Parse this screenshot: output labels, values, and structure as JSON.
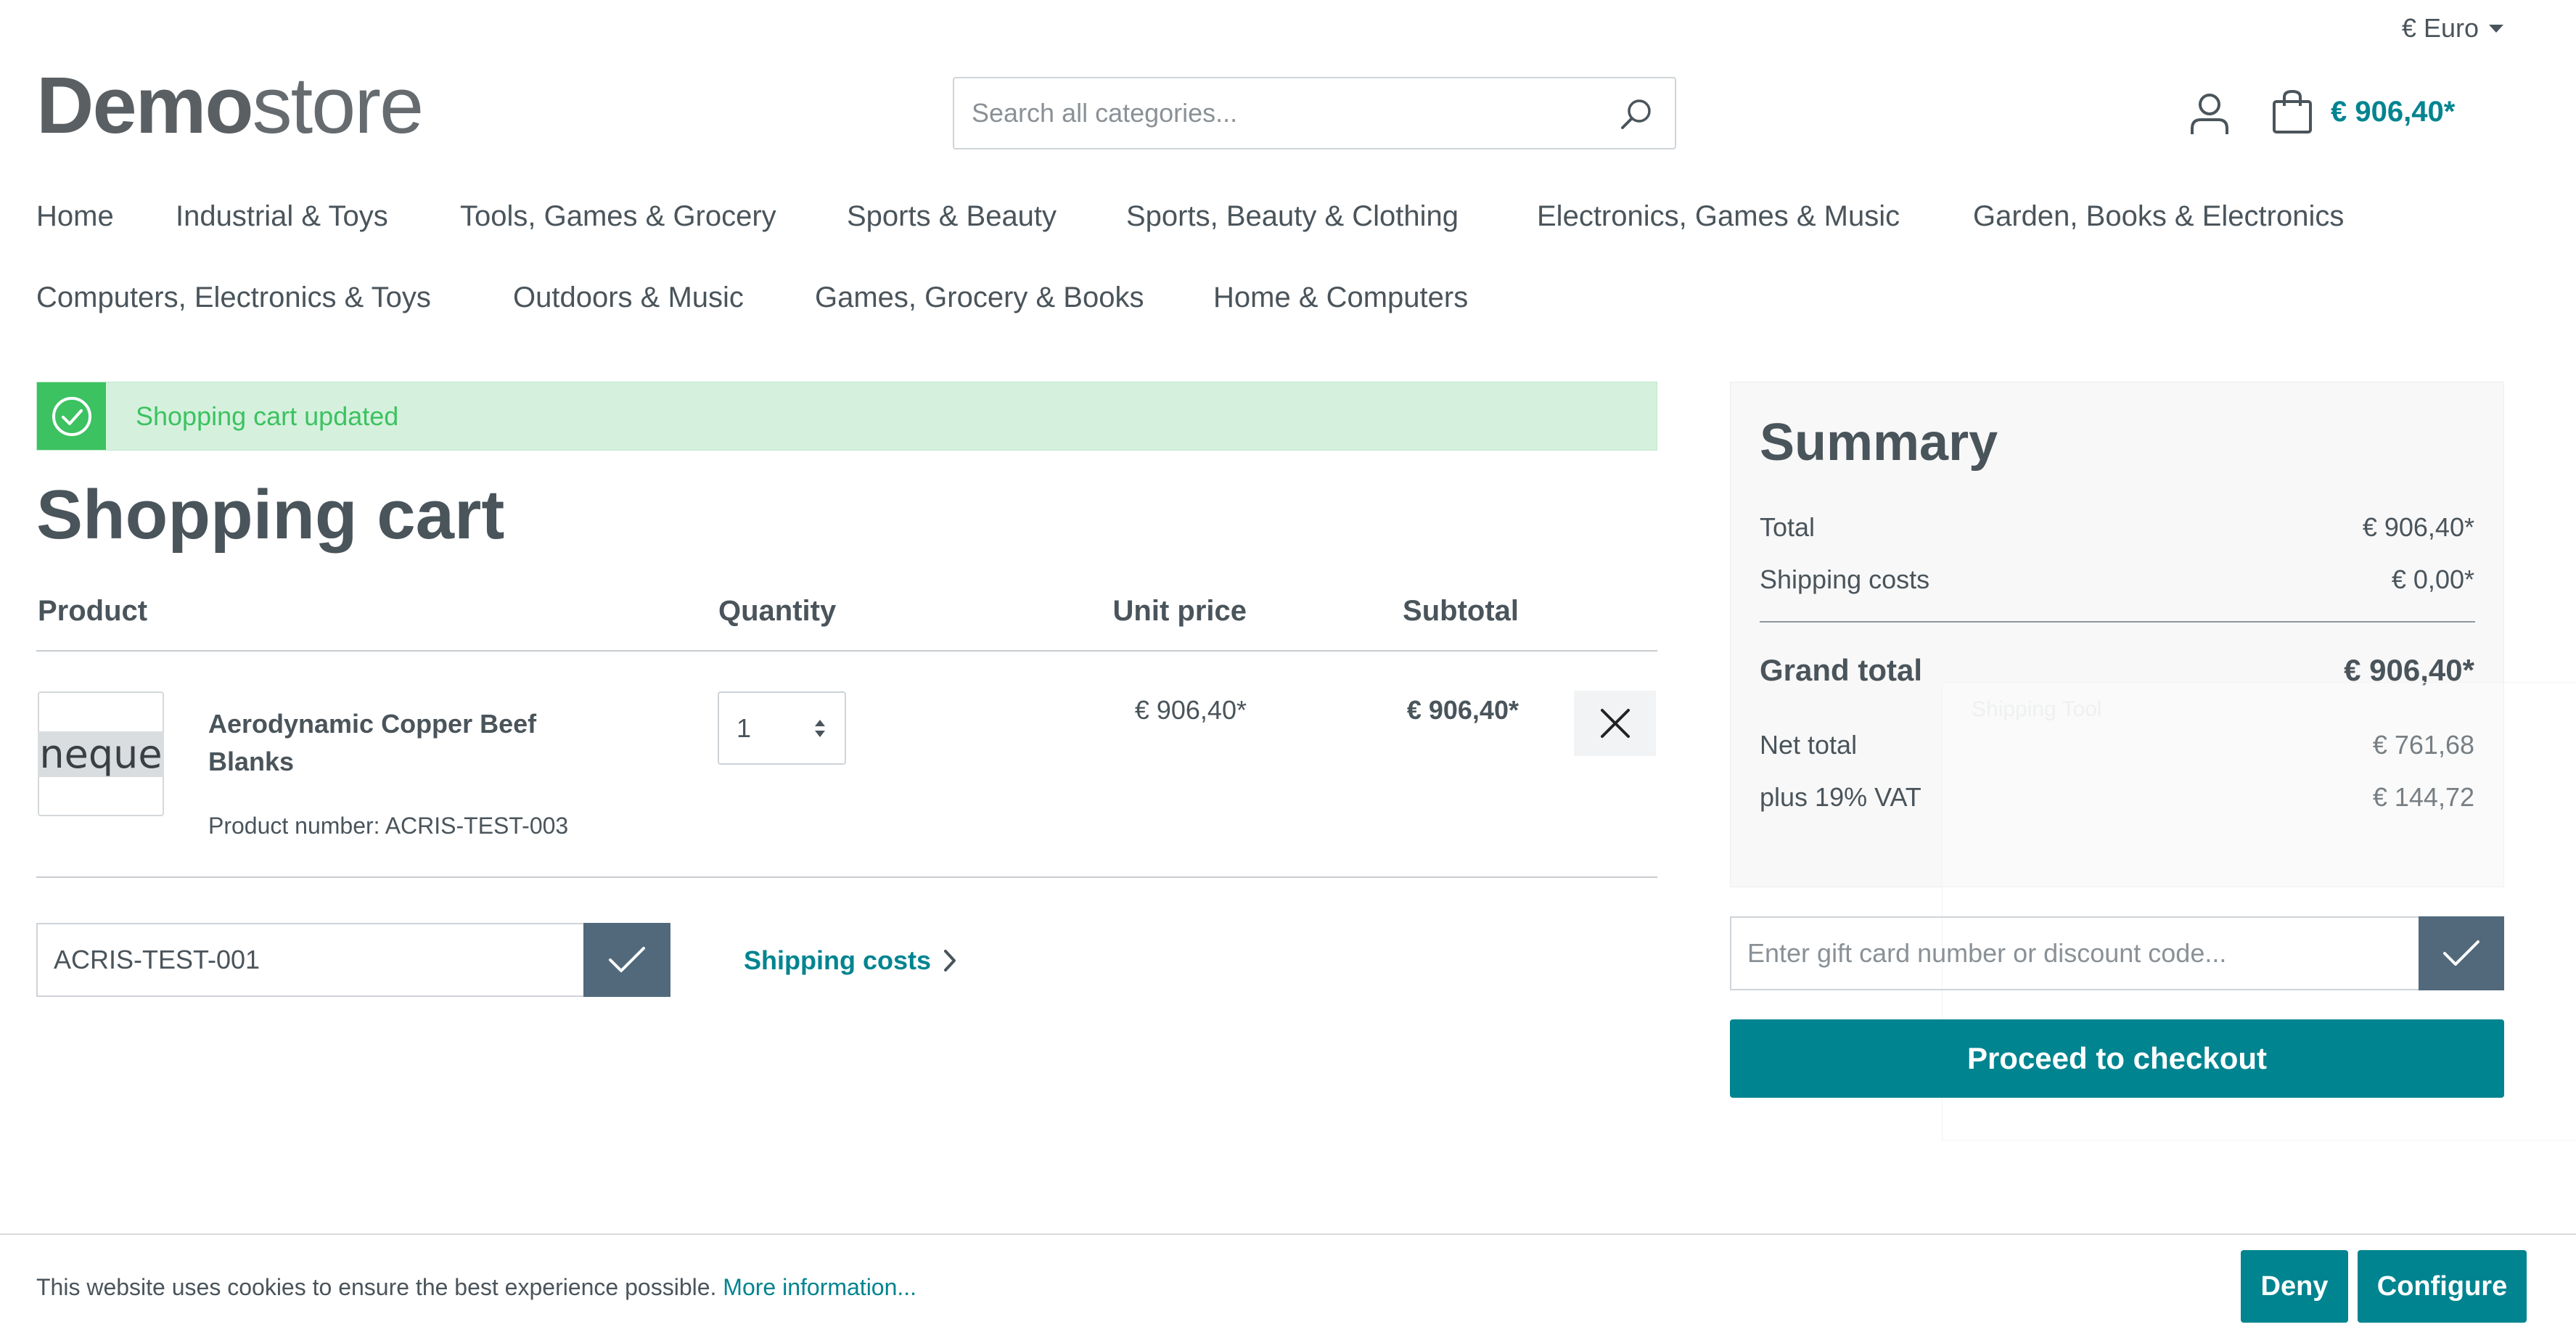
{
  "currency": {
    "label": "€ Euro"
  },
  "logo": {
    "bold": "Demo",
    "light": "store"
  },
  "search": {
    "placeholder": "Search all categories..."
  },
  "header": {
    "cart_total": "€ 906,40*"
  },
  "nav": {
    "row1": [
      "Home",
      "Industrial & Toys",
      "Tools, Games & Grocery",
      "Sports & Beauty",
      "Sports, Beauty & Clothing",
      "Electronics, Games & Music",
      "Garden, Books & Electronics"
    ],
    "row2": [
      "Computers, Electronics & Toys",
      "Outdoors & Music",
      "Games, Grocery & Books",
      "Home & Computers"
    ]
  },
  "alert": {
    "message": "Shopping cart updated",
    "color": "#3cc261"
  },
  "cart": {
    "title": "Shopping cart",
    "headers": {
      "product": "Product",
      "quantity": "Quantity",
      "unit_price": "Unit price",
      "subtotal": "Subtotal"
    },
    "items": [
      {
        "thumb_text": "neque",
        "name": "Aerodynamic Copper Beef Blanks",
        "product_number": "Product number: ACRIS-TEST-003",
        "quantity": "1",
        "unit_price": "€ 906,40*",
        "subtotal": "€ 906,40*"
      }
    ],
    "promo_value": "ACRIS-TEST-001",
    "shipping_link": "Shipping costs"
  },
  "summary": {
    "title": "Summary",
    "total_label": "Total",
    "total_value": "€ 906,40*",
    "shipping_label": "Shipping costs",
    "shipping_value": "€ 0,00*",
    "grand_label": "Grand total",
    "grand_value": "€ 906,40*",
    "net_label": "Net total",
    "net_value": "€ 761,68",
    "vat_label": "plus 19% VAT",
    "vat_value": "€ 144,72",
    "ghost_text": "Shipping Tool",
    "giftcard_placeholder": "Enter gift card number or discount code...",
    "checkout": "Proceed to checkout"
  },
  "cookie": {
    "text": "This website uses cookies to ensure the best experience possible.",
    "more": "More information...",
    "deny": "Deny",
    "configure": "Configure"
  },
  "colors": {
    "accent": "#008490",
    "button_dark": "#51697b",
    "text": "#4a545b"
  }
}
